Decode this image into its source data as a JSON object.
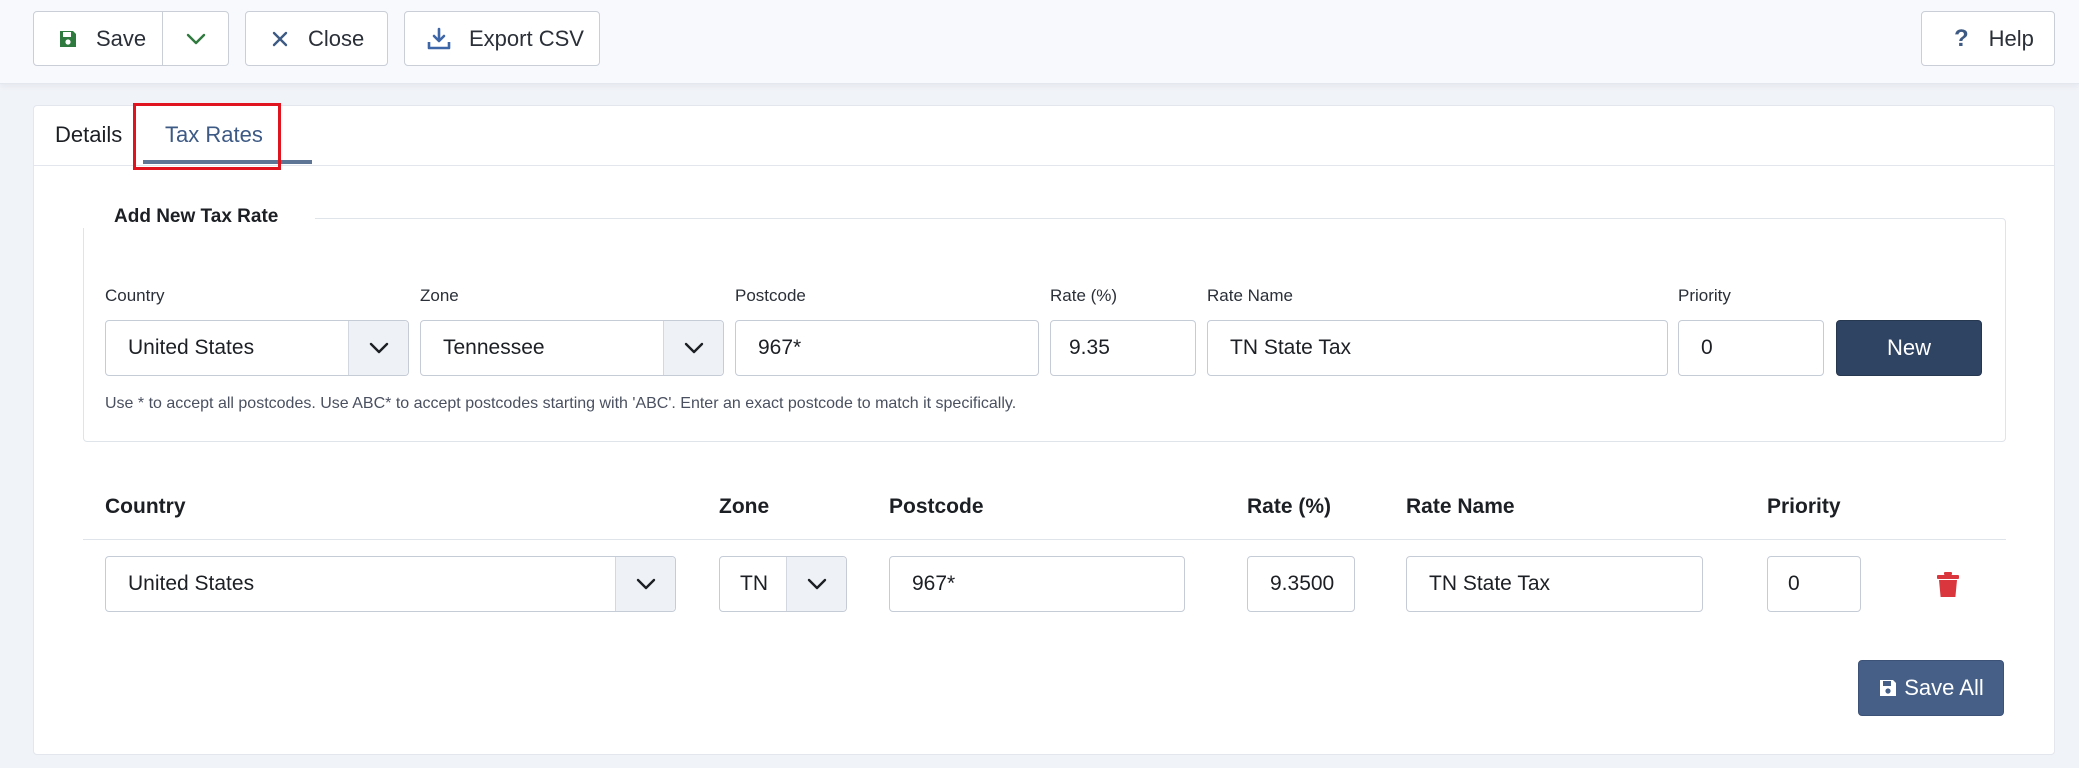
{
  "toolbar": {
    "save_label": "Save",
    "close_label": "Close",
    "export_label": "Export CSV",
    "help_label": "Help"
  },
  "tabs": [
    {
      "label": "Details",
      "active": false
    },
    {
      "label": "Tax Rates",
      "active": true
    }
  ],
  "add_form": {
    "legend": "Add New Tax Rate",
    "country_label": "Country",
    "country_value": "United States",
    "zone_label": "Zone",
    "zone_value": "Tennessee",
    "postcode_label": "Postcode",
    "postcode_value": "967*",
    "rate_label": "Rate (%)",
    "rate_value": "9.35",
    "rate_name_label": "Rate Name",
    "rate_name_value": "TN State Tax",
    "priority_label": "Priority",
    "priority_value": "0",
    "new_button": "New",
    "help_text": "Use * to accept all postcodes. Use ABC* to accept postcodes starting with 'ABC'. Enter an exact postcode to match it specifically."
  },
  "table": {
    "columns": [
      "Country",
      "Zone",
      "Postcode",
      "Rate (%)",
      "Rate Name",
      "Priority"
    ],
    "rows": [
      {
        "country": "United States",
        "zone": "TN",
        "postcode": "967*",
        "rate": "9.3500",
        "rate_name": "TN State Tax",
        "priority": "0"
      }
    ]
  },
  "save_all_label": "Save All",
  "colors": {
    "primary_dark": "#2f4363",
    "primary": "#465f87",
    "tab_active": "#3d5a85",
    "delete": "#d9363e",
    "highlight": "#e0141e"
  }
}
